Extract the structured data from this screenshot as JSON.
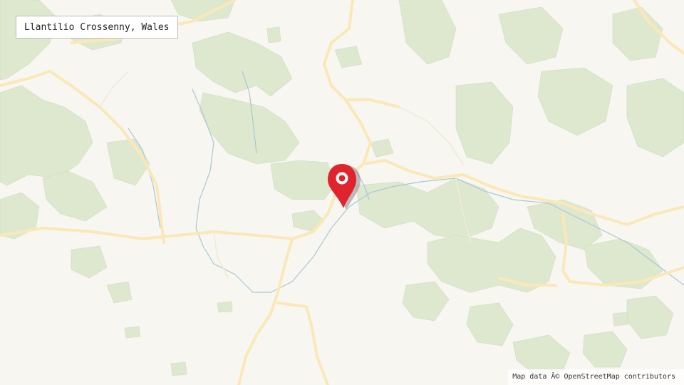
{
  "map": {
    "location_label": "Llantilio Crossenny, Wales",
    "attribution": "Map data Â© OpenStreetMap contributors",
    "marker_icon": "map-pin-icon",
    "colors": {
      "land": "#f8f6f1",
      "woodland": "#dde8cf",
      "road": "#fdefc9",
      "water": "#aac8d6",
      "marker": "#e0242d"
    }
  }
}
